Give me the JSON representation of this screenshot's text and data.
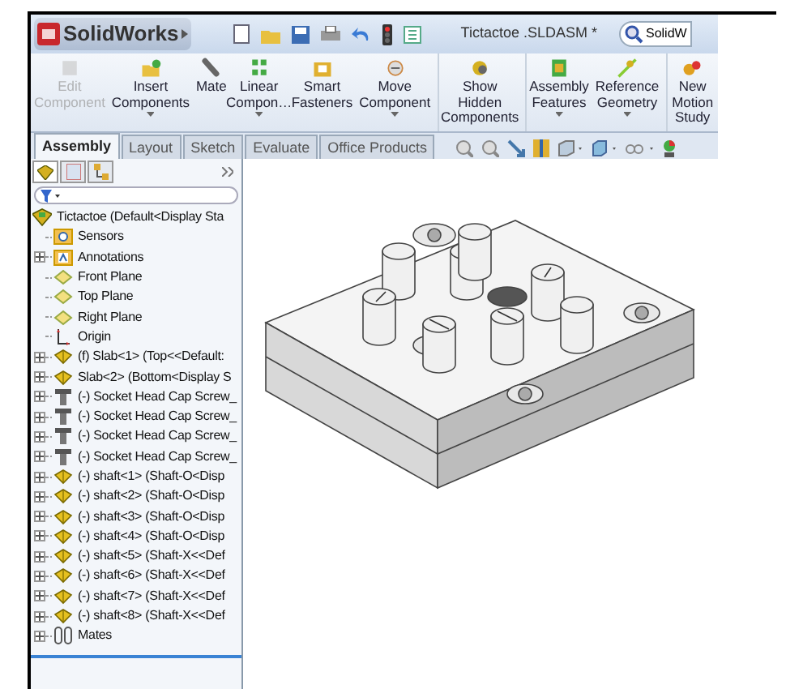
{
  "app": {
    "name": "SolidWorks",
    "document": "Tictactoe .SLDASM *",
    "search": "SolidW"
  },
  "ribbon": [
    {
      "label": "Edit Component",
      "disabled": true,
      "dropdown": false,
      "kind": "edit"
    },
    {
      "label": "Insert Components",
      "disabled": false,
      "dropdown": true,
      "kind": "insert"
    },
    {
      "label": "Mate",
      "disabled": false,
      "dropdown": false,
      "kind": "mate"
    },
    {
      "label": "Linear Compon…",
      "disabled": false,
      "dropdown": true,
      "kind": "linear"
    },
    {
      "label": "Smart Fasteners",
      "disabled": false,
      "dropdown": false,
      "kind": "fastener"
    },
    {
      "label": "Move Component",
      "disabled": false,
      "dropdown": true,
      "kind": "move"
    },
    {
      "label": "Show Hidden Components",
      "disabled": false,
      "dropdown": false,
      "kind": "show"
    },
    {
      "label": "Assembly Features",
      "disabled": false,
      "dropdown": true,
      "kind": "features"
    },
    {
      "label": "Reference Geometry",
      "disabled": false,
      "dropdown": true,
      "kind": "geometry"
    },
    {
      "label": "New Motion Study",
      "disabled": false,
      "dropdown": false,
      "kind": "motion"
    }
  ],
  "tabs": [
    {
      "label": "Assembly",
      "selected": true
    },
    {
      "label": "Layout",
      "selected": false
    },
    {
      "label": "Sketch",
      "selected": false
    },
    {
      "label": "Evaluate",
      "selected": false
    },
    {
      "label": "Office Products",
      "selected": false
    }
  ],
  "tree": {
    "label": "Tictactoe  (Default<Display Sta",
    "kind": "assembly",
    "children": [
      {
        "label": "Sensors",
        "kind": "sensor",
        "expandable": false
      },
      {
        "label": "Annotations",
        "kind": "annotation",
        "expandable": true
      },
      {
        "label": "Front Plane",
        "kind": "plane",
        "expandable": false
      },
      {
        "label": "Top Plane",
        "kind": "plane",
        "expandable": false
      },
      {
        "label": "Right Plane",
        "kind": "plane",
        "expandable": false
      },
      {
        "label": "Origin",
        "kind": "origin",
        "expandable": false
      },
      {
        "label": "(f) Slab<1> (Top<<Default:",
        "kind": "part",
        "expandable": true
      },
      {
        "label": "Slab<2> (Bottom<Display S",
        "kind": "part",
        "expandable": true
      },
      {
        "label": "(-) Socket Head Cap Screw_",
        "kind": "screw",
        "expandable": true
      },
      {
        "label": "(-) Socket Head Cap Screw_",
        "kind": "screw",
        "expandable": true
      },
      {
        "label": "(-) Socket Head Cap Screw_",
        "kind": "screw",
        "expandable": true
      },
      {
        "label": "(-) Socket Head Cap Screw_",
        "kind": "screw",
        "expandable": true
      },
      {
        "label": "(-) shaft<1> (Shaft-O<Disp",
        "kind": "part",
        "expandable": true
      },
      {
        "label": "(-) shaft<2> (Shaft-O<Disp",
        "kind": "part",
        "expandable": true
      },
      {
        "label": "(-) shaft<3> (Shaft-O<Disp",
        "kind": "part",
        "expandable": true
      },
      {
        "label": "(-) shaft<4> (Shaft-O<Disp",
        "kind": "part",
        "expandable": true
      },
      {
        "label": "(-) shaft<5> (Shaft-X<<Def",
        "kind": "part",
        "expandable": true
      },
      {
        "label": "(-) shaft<6> (Shaft-X<<Def",
        "kind": "part",
        "expandable": true
      },
      {
        "label": "(-) shaft<7> (Shaft-X<<Def",
        "kind": "part",
        "expandable": true
      },
      {
        "label": "(-) shaft<8> (Shaft-X<<Def",
        "kind": "part",
        "expandable": true
      },
      {
        "label": "Mates",
        "kind": "mates",
        "expandable": true
      }
    ]
  }
}
